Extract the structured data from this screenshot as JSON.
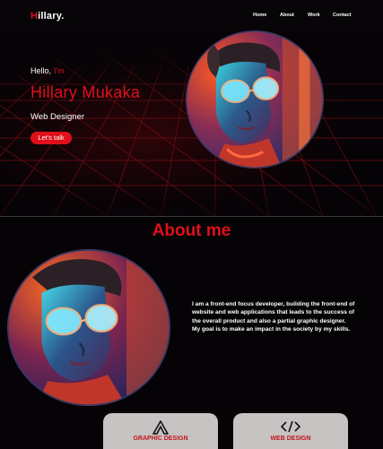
{
  "nav": {
    "logo_initial": "H",
    "logo_rest": "illary",
    "logo_dot": ".",
    "links": [
      "Home",
      "About",
      "Work",
      "Contact"
    ]
  },
  "hero": {
    "greeting": "Hello,",
    "greeting_accent": "I'm",
    "name": "Hillary Mukaka",
    "role": "Web Designer",
    "cta_label": "Let's talk"
  },
  "about": {
    "title": "About me",
    "paragraph_1": "I am a front-end focus developer, building the front-end of website and web applications that leads to the success of the overall product and also a partial graphic designer.",
    "paragraph_2": "My goal is to make an impact in the society by my skills."
  },
  "services": [
    {
      "label": "GRAPHIC DESIGN",
      "icon": "graphic-design-icon"
    },
    {
      "label": "WEB DESIGN",
      "icon": "code-brackets-icon"
    }
  ],
  "colors": {
    "accent": "#e0101a",
    "background": "#050305",
    "card": "#c7c3c3"
  }
}
